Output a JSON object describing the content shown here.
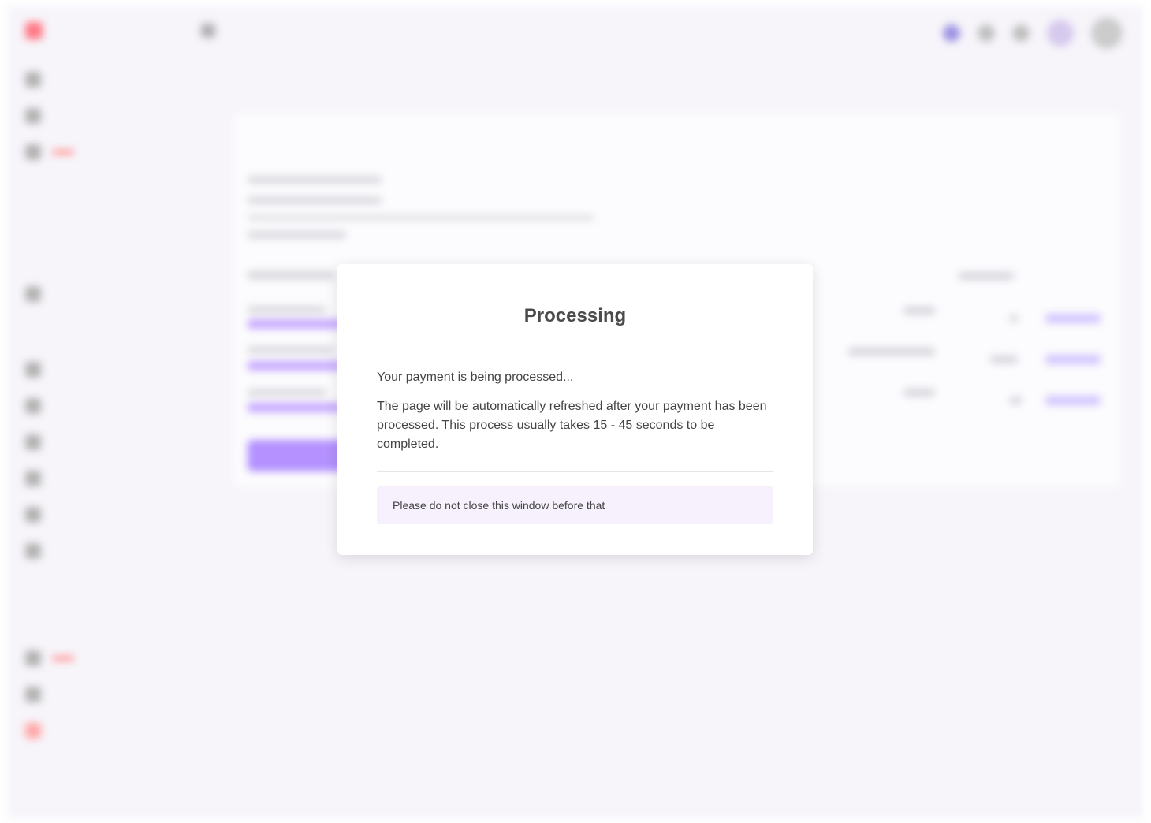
{
  "modal": {
    "title": "Processing",
    "message": "Your payment is being processed...",
    "detail": "The page will be automatically refreshed after your payment has been processed. This process usually takes 15 - 45 seconds to be completed.",
    "notice": "Please do not close this window before that"
  },
  "colors": {
    "brand": "#ff4d5e",
    "accent": "#9b6dff",
    "notice_bg": "#f6f1fd",
    "logout": "#ff5b5b"
  }
}
